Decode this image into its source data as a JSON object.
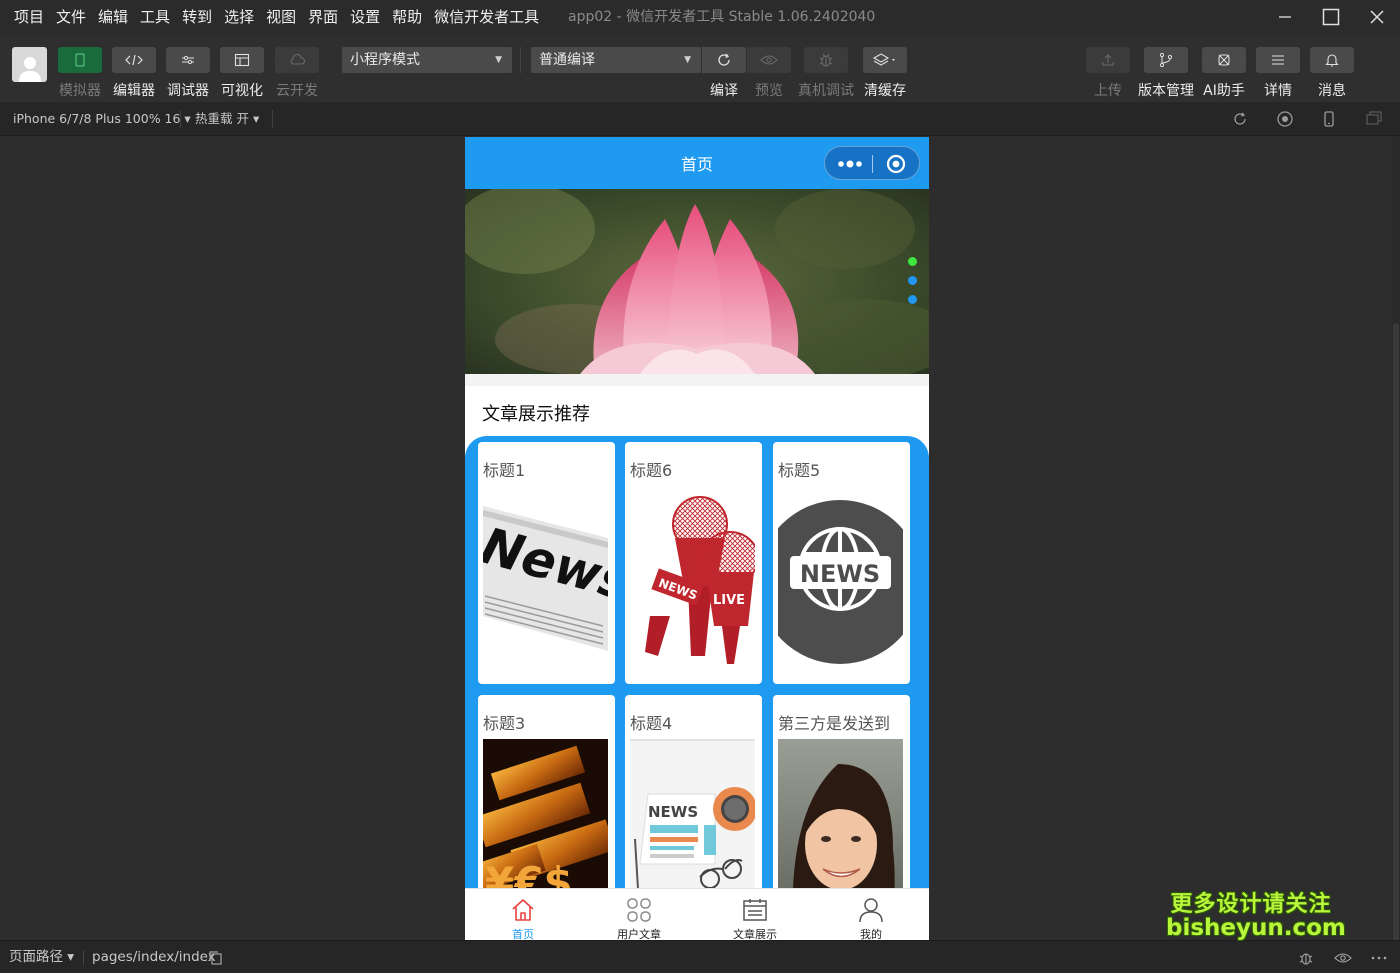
{
  "menu": [
    "项目",
    "文件",
    "编辑",
    "工具",
    "转到",
    "选择",
    "视图",
    "界面",
    "设置",
    "帮助",
    "微信开发者工具"
  ],
  "window": {
    "title": "app02 - 微信开发者工具 Stable 1.06.2402040"
  },
  "toolbar": {
    "left_buttons": [
      {
        "label": "模拟器",
        "icon": "phone-icon"
      },
      {
        "label": "编辑器",
        "icon": "code-icon"
      },
      {
        "label": "调试器",
        "icon": "debug-icon"
      },
      {
        "label": "可视化",
        "icon": "layout-icon"
      },
      {
        "label": "云开发",
        "icon": "cloud-icon"
      }
    ],
    "mode_select": "小程序模式",
    "compile_select": "普通编译",
    "action_buttons": [
      {
        "label": "编译",
        "icon": "refresh-icon"
      },
      {
        "label": "预览",
        "icon": "eye-icon"
      },
      {
        "label": "真机调试",
        "icon": "bug-icon"
      },
      {
        "label": "清缓存",
        "icon": "layers-icon"
      }
    ],
    "right_buttons": [
      {
        "label": "上传",
        "icon": "upload-icon"
      },
      {
        "label": "版本管理",
        "icon": "branch-icon"
      },
      {
        "label": "AI助手",
        "icon": "ai-icon"
      },
      {
        "label": "详情",
        "icon": "menu-lines-icon"
      },
      {
        "label": "消息",
        "icon": "bell-icon"
      }
    ]
  },
  "subbar": {
    "device": "iPhone 6/7/8 Plus 100% 16 ▾",
    "hot_reload": "热重载 开 ▾"
  },
  "phone": {
    "nav_title": "首页",
    "banner_dots": 3,
    "banner_active_index": 0,
    "section_title": "文章展示推荐",
    "cards": [
      {
        "title": "标题1",
        "image": "news-newspaper"
      },
      {
        "title": "标题6",
        "image": "news-live-microphones"
      },
      {
        "title": "标题5",
        "image": "news-globe"
      },
      {
        "title": "标题3",
        "image": "gold-bars"
      },
      {
        "title": "标题4",
        "image": "news-paper-glasses"
      },
      {
        "title": "第三方是发送到",
        "image": "woman-portrait"
      }
    ],
    "tabs": [
      {
        "label": "首页",
        "icon": "home-icon",
        "active": true
      },
      {
        "label": "用户文章",
        "icon": "grid-icon",
        "active": false
      },
      {
        "label": "文章展示",
        "icon": "calendar-icon",
        "active": false
      },
      {
        "label": "我的",
        "icon": "user-icon",
        "active": false
      }
    ]
  },
  "statusbar": {
    "path_label": "页面路径 ▾",
    "path": "pages/index/index"
  },
  "watermark": {
    "line1": "更多设计请关注",
    "line2": "bisheyun.com"
  },
  "colors": {
    "primary": "#1e9af0",
    "tab_active": "#e64340",
    "simulator_green": "#1a6b3c"
  }
}
